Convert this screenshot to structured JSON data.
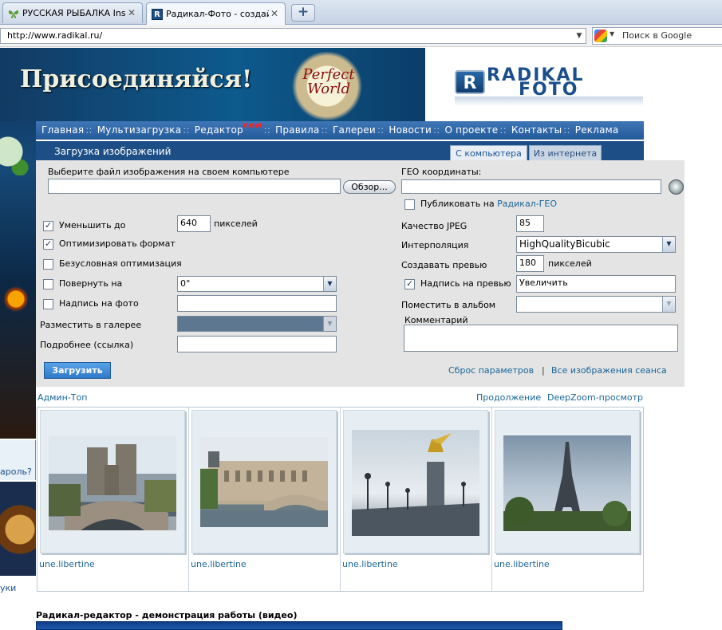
{
  "browser": {
    "tabs": [
      {
        "title": "РУССКАЯ РЫБАЛКА Ins...",
        "icon": "butterfly-icon",
        "active": false
      },
      {
        "title": "Радикал-Фото - создай...",
        "icon": "radikal-icon",
        "active": true
      }
    ],
    "new_tab_label": "+",
    "url": "http://www.radikal.ru/",
    "search_placeholder": "Поиск в Google"
  },
  "banner": {
    "ad_text": "Присоединяйся!",
    "ad_logo_text": "Perfect World",
    "site_logo_letter": "R",
    "site_logo_line1": "RADIKAL",
    "site_logo_line2": "FOTO"
  },
  "menu": {
    "items": [
      "Главная",
      "Мультизагрузка",
      "Редактор",
      "Правила",
      "Галереи",
      "Новости",
      "О проекте",
      "Контакты",
      "Реклама"
    ],
    "separator": "::",
    "new_badge": "new"
  },
  "upload": {
    "section_title": "Загрузка изображений",
    "tab_computer": "С компьютера",
    "tab_internet": "Из интернета",
    "file_label": "Выберите файл изображения на своем компьютере",
    "file_value": "",
    "browse_label": "Обзор...",
    "geo_label": "ГЕО координаты:",
    "geo_value": "",
    "geo_publish_prefix": "Публиковать на",
    "geo_publish_link": "Радикал-ГЕО",
    "reduce_label": "Уменьшить до",
    "reduce_value": "640",
    "reduce_unit": "пикселей",
    "reduce_checked": true,
    "optimize_label": "Оптимизировать формат",
    "optimize_checked": true,
    "force_opt_label": "Безусловная оптимизация",
    "force_opt_checked": false,
    "rotate_label": "Повернуть на",
    "rotate_value": "0°",
    "rotate_checked": false,
    "caption_label": "Надпись на фото",
    "caption_value": "",
    "caption_checked": false,
    "gallery_label": "Разместить в галерее",
    "gallery_value": "",
    "details_label": "Подробнее (ссылка)",
    "details_value": "",
    "jpeg_label": "Качество JPEG",
    "jpeg_value": "85",
    "interp_label": "Интерполяция",
    "interp_value": "HighQualityBicubic",
    "preview_label": "Создавать превью",
    "preview_value": "180",
    "preview_unit": "пикселей",
    "preview_caption_label": "Надпись на превью",
    "preview_caption_value": "Увеличить",
    "preview_caption_checked": true,
    "album_label": "Поместить в альбом",
    "album_value": "",
    "comment_label": "Комментарий",
    "comment_value": "",
    "submit_label": "Загрузить",
    "reset_link": "Сброс параметров",
    "links_sep": "|",
    "session_link": "Все изображения сеанса"
  },
  "gallery": {
    "admin_link": "Админ-Топ",
    "more_link": "Продолжение",
    "deepzoom_link": "DeepZoom-просмотр",
    "items": [
      {
        "author": "une.libertine",
        "photo": "notre-dame-photo"
      },
      {
        "author": "une.libertine",
        "photo": "louvre-photo"
      },
      {
        "author": "une.libertine",
        "photo": "bridge-statue-photo"
      },
      {
        "author": "une.libertine",
        "photo": "eiffel-tower-photo"
      }
    ]
  },
  "left": {
    "password_text": "ароль?",
    "link_text": "уки"
  },
  "demo": {
    "title": "Радикал-редактор - демонстрация работы (видео)"
  }
}
